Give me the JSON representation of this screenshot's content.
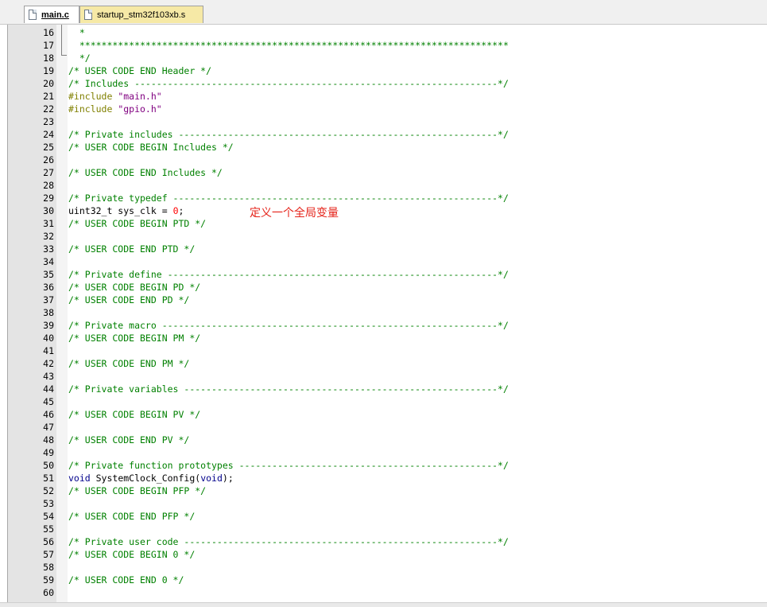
{
  "tabs": [
    {
      "label": "main.c",
      "active": true,
      "icon": "file-icon"
    },
    {
      "label": "startup_stm32f103xb.s",
      "active": false,
      "icon": "file-icon"
    }
  ],
  "colors": {
    "comment": "#008000",
    "preprocessor": "#808000",
    "string": "#800080",
    "keyword": "#00008b",
    "number": "#ff0000",
    "annotation": "#e5231a",
    "gutter": "#e4e4e4",
    "active_tab_bg": "#ffffff",
    "inactive_tab_bg": "#f6e9a6"
  },
  "lines": [
    {
      "n": "16",
      "parts": [
        [
          "cm",
          "  *"
        ]
      ]
    },
    {
      "n": "17",
      "parts": [
        [
          "cm",
          "  ******************************************************************************"
        ]
      ]
    },
    {
      "n": "18",
      "parts": [
        [
          "cm",
          "  */"
        ]
      ]
    },
    {
      "n": "19",
      "parts": [
        [
          "cm",
          "/* USER CODE END Header */"
        ]
      ]
    },
    {
      "n": "20",
      "parts": [
        [
          "cm",
          "/* Includes ------------------------------------------------------------------*/"
        ]
      ]
    },
    {
      "n": "21",
      "parts": [
        [
          "pp",
          "#include "
        ],
        [
          "str",
          "\"main.h\""
        ]
      ]
    },
    {
      "n": "22",
      "parts": [
        [
          "pp",
          "#include "
        ],
        [
          "str",
          "\"gpio.h\""
        ]
      ]
    },
    {
      "n": "23",
      "parts": []
    },
    {
      "n": "24",
      "parts": [
        [
          "cm",
          "/* Private includes ----------------------------------------------------------*/"
        ]
      ]
    },
    {
      "n": "25",
      "parts": [
        [
          "cm",
          "/* USER CODE BEGIN Includes */"
        ]
      ]
    },
    {
      "n": "26",
      "parts": []
    },
    {
      "n": "27",
      "parts": [
        [
          "cm",
          "/* USER CODE END Includes */"
        ]
      ]
    },
    {
      "n": "28",
      "parts": []
    },
    {
      "n": "29",
      "parts": [
        [
          "cm",
          "/* Private typedef -----------------------------------------------------------*/"
        ]
      ]
    },
    {
      "n": "30",
      "parts": [
        [
          "tx",
          "uint32_t sys_clk = "
        ],
        [
          "num",
          "0"
        ],
        [
          "tx",
          ";"
        ]
      ]
    },
    {
      "n": "31",
      "parts": [
        [
          "cm",
          "/* USER CODE BEGIN PTD */"
        ]
      ]
    },
    {
      "n": "32",
      "parts": []
    },
    {
      "n": "33",
      "parts": [
        [
          "cm",
          "/* USER CODE END PTD */"
        ]
      ]
    },
    {
      "n": "34",
      "parts": []
    },
    {
      "n": "35",
      "parts": [
        [
          "cm",
          "/* Private define ------------------------------------------------------------*/"
        ]
      ]
    },
    {
      "n": "36",
      "parts": [
        [
          "cm",
          "/* USER CODE BEGIN PD */"
        ]
      ]
    },
    {
      "n": "37",
      "parts": [
        [
          "cm",
          "/* USER CODE END PD */"
        ]
      ]
    },
    {
      "n": "38",
      "parts": []
    },
    {
      "n": "39",
      "parts": [
        [
          "cm",
          "/* Private macro -------------------------------------------------------------*/"
        ]
      ]
    },
    {
      "n": "40",
      "parts": [
        [
          "cm",
          "/* USER CODE BEGIN PM */"
        ]
      ]
    },
    {
      "n": "41",
      "parts": []
    },
    {
      "n": "42",
      "parts": [
        [
          "cm",
          "/* USER CODE END PM */"
        ]
      ]
    },
    {
      "n": "43",
      "parts": []
    },
    {
      "n": "44",
      "parts": [
        [
          "cm",
          "/* Private variables ---------------------------------------------------------*/"
        ]
      ]
    },
    {
      "n": "45",
      "parts": []
    },
    {
      "n": "46",
      "parts": [
        [
          "cm",
          "/* USER CODE BEGIN PV */"
        ]
      ]
    },
    {
      "n": "47",
      "parts": []
    },
    {
      "n": "48",
      "parts": [
        [
          "cm",
          "/* USER CODE END PV */"
        ]
      ]
    },
    {
      "n": "49",
      "parts": []
    },
    {
      "n": "50",
      "parts": [
        [
          "cm",
          "/* Private function prototypes -----------------------------------------------*/"
        ]
      ]
    },
    {
      "n": "51",
      "parts": [
        [
          "kw",
          "void"
        ],
        [
          "tx",
          " SystemClock_Config("
        ],
        [
          "kw",
          "void"
        ],
        [
          "tx",
          ");"
        ]
      ]
    },
    {
      "n": "52",
      "parts": [
        [
          "cm",
          "/* USER CODE BEGIN PFP */"
        ]
      ]
    },
    {
      "n": "53",
      "parts": []
    },
    {
      "n": "54",
      "parts": [
        [
          "cm",
          "/* USER CODE END PFP */"
        ]
      ]
    },
    {
      "n": "55",
      "parts": []
    },
    {
      "n": "56",
      "parts": [
        [
          "cm",
          "/* Private user code ---------------------------------------------------------*/"
        ]
      ]
    },
    {
      "n": "57",
      "parts": [
        [
          "cm",
          "/* USER CODE BEGIN 0 */"
        ]
      ]
    },
    {
      "n": "58",
      "parts": []
    },
    {
      "n": "59",
      "parts": [
        [
          "cm",
          "/* USER CODE END 0 */"
        ]
      ]
    },
    {
      "n": "60",
      "parts": []
    }
  ],
  "annotation": {
    "text": "定义一个全局变量"
  }
}
